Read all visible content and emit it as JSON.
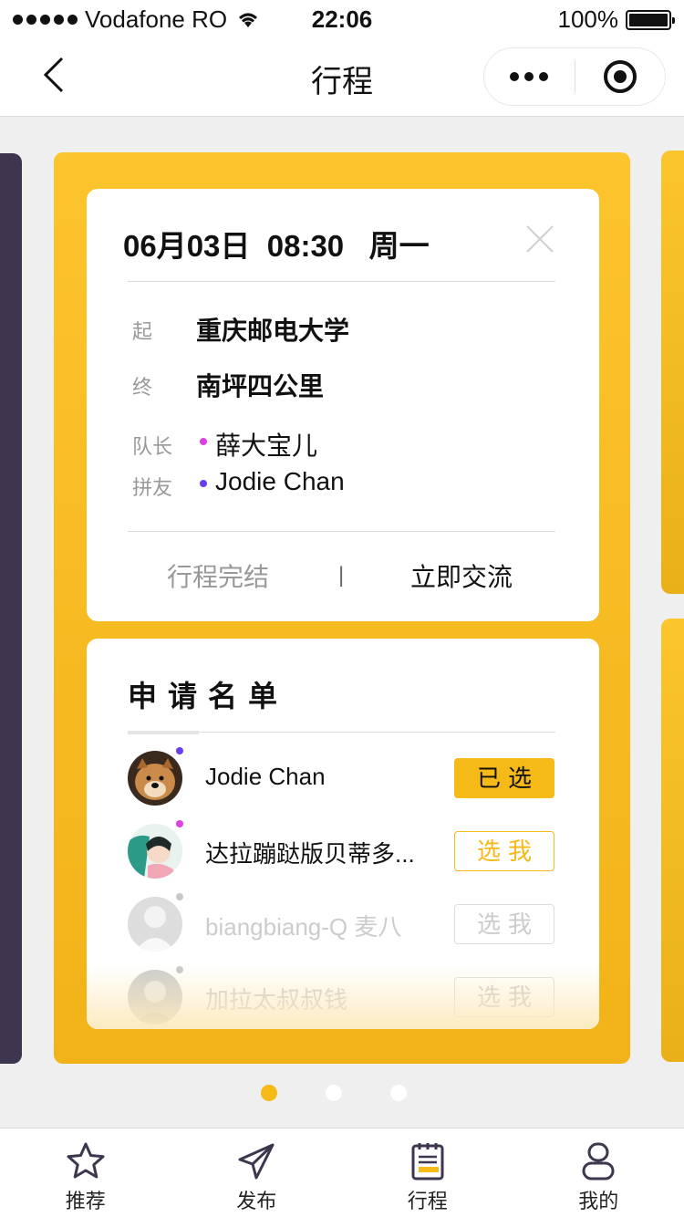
{
  "status_bar": {
    "carrier": "Vodafone RO",
    "time": "22:06",
    "battery": "100%"
  },
  "navbar": {
    "title": "行程"
  },
  "trip": {
    "date": "06月03日  08:30   周一",
    "start_label": "起",
    "start": "重庆邮电大学",
    "end_label": "终",
    "end": "南坪四公里",
    "leader_label": "队长",
    "leader": "薛大宝儿",
    "partner_label": "拼友",
    "partner": "Jodie Chan",
    "action_finish": "行程完结",
    "action_divider": "|",
    "action_chat": "立即交流"
  },
  "applications": {
    "title": "申请名单",
    "items": [
      {
        "name": "Jodie Chan",
        "button": "已选",
        "state": "selected",
        "dot_color": "#6a3df0"
      },
      {
        "name": "达拉蹦跶版贝蒂多...",
        "button": "选我",
        "state": "choose",
        "dot_color": "#e040e0"
      },
      {
        "name": "biangbiang-Q 麦八",
        "button": "选我",
        "state": "disabled",
        "dot_color": "#c8c8c8"
      },
      {
        "name": "加拉太叔叔钱",
        "button": "选我",
        "state": "disabled",
        "dot_color": "#c8c8c8"
      }
    ]
  },
  "pager": {
    "active_index": 0,
    "count": 3,
    "active_color": "#f5b918"
  },
  "tabbar": {
    "items": [
      {
        "label": "推荐",
        "icon": "star-icon"
      },
      {
        "label": "发布",
        "icon": "paper-plane-icon"
      },
      {
        "label": "行程",
        "icon": "notepad-icon"
      },
      {
        "label": "我的",
        "icon": "person-icon"
      }
    ]
  },
  "colors": {
    "accent": "#f5b918",
    "card_yellow": "#fcc42d",
    "side_dark": "#3e354e",
    "leader_dot": "#e040e0",
    "partner_dot": "#6a3df0"
  }
}
